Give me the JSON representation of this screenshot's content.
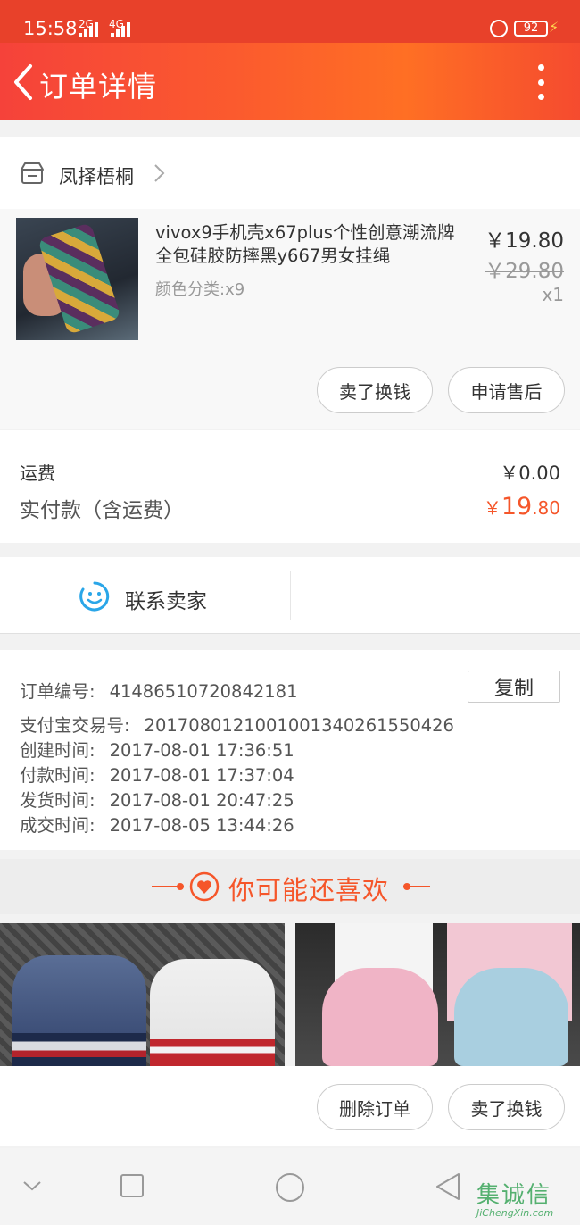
{
  "status_bar": {
    "time": "15:58",
    "net1": "2G",
    "net2": "4G",
    "battery": "92"
  },
  "header": {
    "title": "订单详情"
  },
  "shop": {
    "name": "凤择梧桐"
  },
  "item": {
    "title": "vivox9手机壳x67plus个性创意潮流牌全包硅胶防摔黑y667男女挂绳",
    "spec": "颜色分类:x9",
    "price": "￥19.80",
    "original_price": "￥29.80",
    "quantity": "x1",
    "btn_sell": "卖了换钱",
    "btn_after_sale": "申请售后"
  },
  "fees": {
    "shipping_label": "运费",
    "shipping_value": "￥0.00",
    "paid_label": "实付款（含运费）",
    "paid_yen": "￥",
    "paid_int": "19",
    "paid_dec": ".80"
  },
  "contact": {
    "label": "联系卖家"
  },
  "order_info": {
    "copy_label": "复制",
    "rows": [
      {
        "key": "订单编号:",
        "value": "41486510720842181"
      },
      {
        "key": "支付宝交易号:",
        "value": "2017080121001001340261550426"
      },
      {
        "key": "创建时间:",
        "value": "2017-08-01 17:36:51"
      },
      {
        "key": "付款时间:",
        "value": "2017-08-01 17:37:04"
      },
      {
        "key": "发货时间:",
        "value": "2017-08-01 20:47:25"
      },
      {
        "key": "成交时间:",
        "value": "2017-08-05 13:44:26"
      }
    ]
  },
  "recommend": {
    "title": "你可能还喜欢"
  },
  "actions": {
    "delete": "删除订单",
    "sell": "卖了换钱"
  },
  "watermark": {
    "cn": "集诚信",
    "en": "JiChengXin.com"
  },
  "colors": {
    "brand": "#f5562a",
    "header": "#f5423a"
  }
}
